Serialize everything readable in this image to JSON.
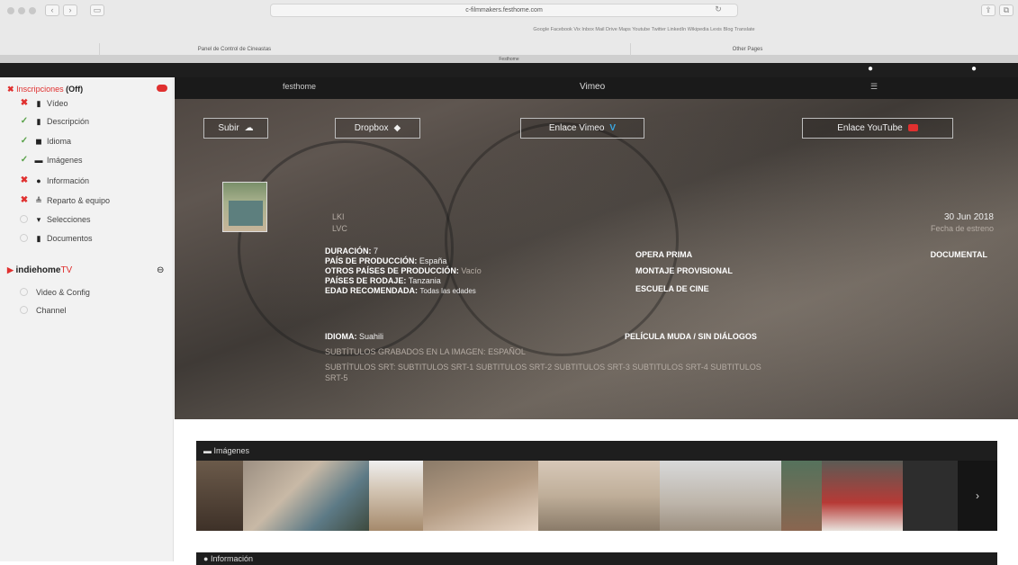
{
  "browser": {
    "url": "c-filmmakers.festhome.com",
    "bookmarks": "Google  Facebook  Vix  Inbox  Mail  Drive  Maps  Youtube  Twitter  LinkedIn  Wikipedia  Lexis  Blog  Translate",
    "tabs": [
      "Panel de Control de Cineastas",
      "Other Pages"
    ],
    "page_tab": "Festhome"
  },
  "sidebar": {
    "inscripciones": {
      "label": "Inscripciones",
      "suffix": "(Off)"
    },
    "items": [
      {
        "label": "Vídeo",
        "status": "x",
        "icon": "file-icon",
        "glyph": "▮"
      },
      {
        "label": "Descripción",
        "status": "ok",
        "icon": "file-icon",
        "glyph": "▮"
      },
      {
        "label": "Idioma",
        "status": "ok",
        "icon": "language-icon",
        "glyph": "◼"
      },
      {
        "label": "Imágenes",
        "status": "ok",
        "icon": "image-icon",
        "glyph": "▬"
      },
      {
        "label": "Información",
        "status": "x",
        "icon": "info-icon",
        "glyph": "●"
      },
      {
        "label": "Reparto & equipo",
        "status": "x",
        "icon": "users-icon",
        "glyph": "≜"
      },
      {
        "label": "Selecciones",
        "status": "none",
        "icon": "trophy-icon",
        "glyph": "▾"
      },
      {
        "label": "Documentos",
        "status": "none",
        "icon": "document-icon",
        "glyph": "▮"
      }
    ],
    "indiehome": {
      "label": "indiehome",
      "suffix": "TV"
    },
    "tv_items": [
      {
        "label": "Video & Config"
      },
      {
        "label": "Channel"
      }
    ]
  },
  "hero": {
    "logo": "festhome",
    "nav_title": "Vimeo",
    "buttons": {
      "subir": "Subir",
      "dropbox": "Dropbox",
      "vimeo": "Enlace Vimeo",
      "youtube": "Enlace YouTube"
    },
    "line1": "LKI",
    "line2": "LVC",
    "date": "30 Jun 2018",
    "date_label": "Fecha de estreno",
    "genre": "DOCUMENTAL",
    "duracion_k": "DURACIÓN:",
    "duracion_v": "7",
    "pais_k": "PAÍS DE PRODUCCIÓN:",
    "pais_v": "España",
    "otros_k": "OTROS PAÍSES DE PRODUCCIÓN:",
    "otros_v": "Vacío",
    "rodaje_k": "PAÍSES DE RODAJE:",
    "rodaje_v": "Tanzania",
    "edad_k": "EDAD RECOMENDADA:",
    "edad_v": "Todas las edades",
    "opera_prima": "OPERA PRIMA",
    "montaje": "MONTAJE PROVISIONAL",
    "escuela": "ESCUELA DE CINE",
    "idioma_k": "IDIOMA:",
    "idioma_v": "Suahili",
    "muda": "PELÍCULA MUDA / SIN DIÁLOGOS",
    "subs_grab_k": "SUBTÍTULOS GRABADOS EN LA IMAGEN:",
    "subs_grab_v": "ESPAÑOL",
    "srt_k": "SUBTÍTULOS SRT:",
    "srt_v": "SUBTITULOS SRT-1  SUBTITULOS SRT-2  SUBTITULOS SRT-3  SUBTITULOS SRT-4  SUBTITULOS",
    "srt_v2": "SRT-5"
  },
  "gallery": {
    "title": "Imágenes",
    "next": "›"
  },
  "info": {
    "title": "Información"
  },
  "colors": {
    "accent_red": "#e0302f",
    "ok_green": "#5aa24a",
    "vimeo_blue": "#3aa6e0"
  }
}
